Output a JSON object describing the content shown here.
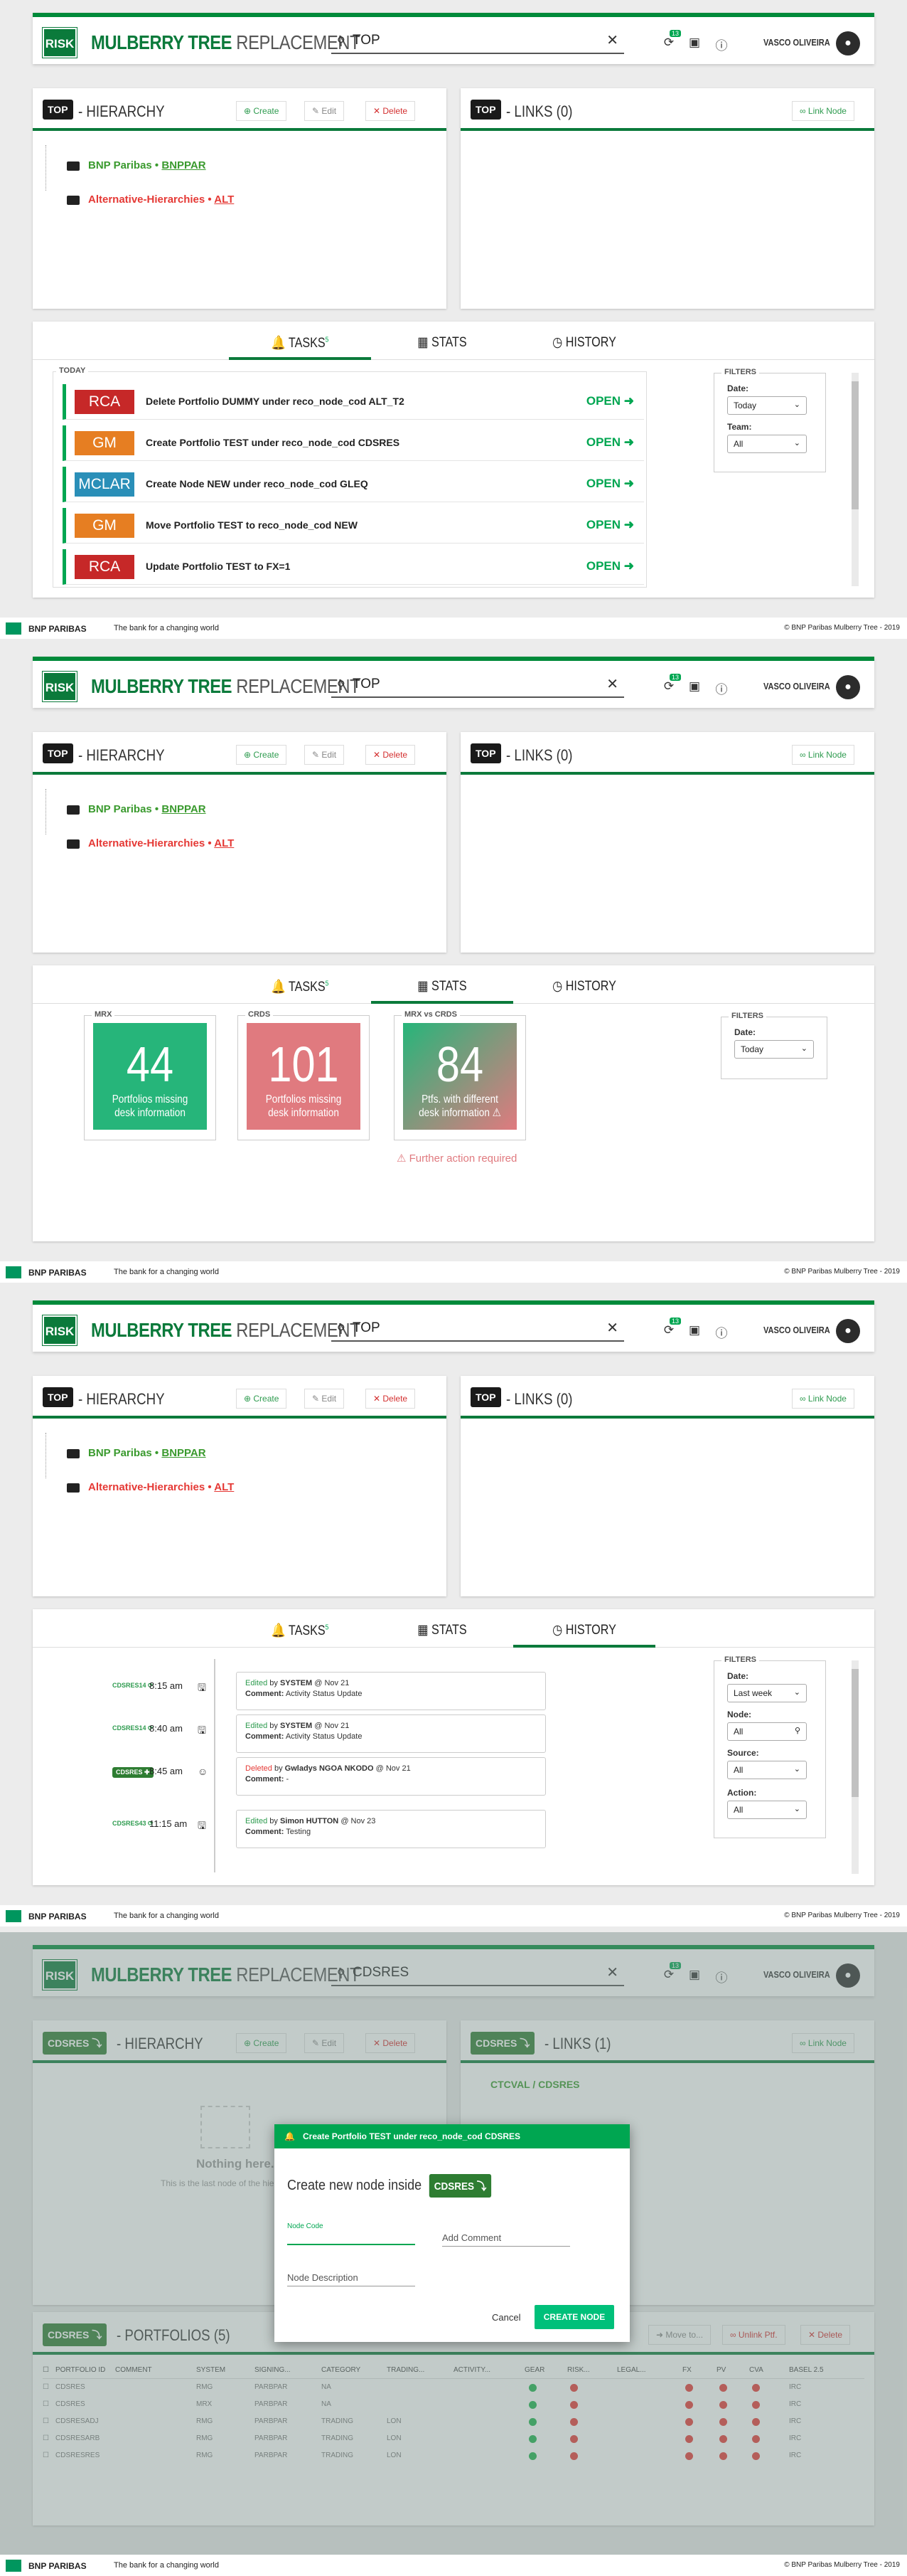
{
  "app": {
    "logo": "RISK",
    "title_bold": "MULBERRY TREE",
    "title_light": "REPLACEMENT",
    "user": "VASCO OLIVEIRA",
    "notif_count": "13"
  },
  "search": {
    "value_top": "TOP",
    "value_cdsres": "CDSRES"
  },
  "hierarchy": {
    "tag": "TOP",
    "title": "- HIERARCHY",
    "create": "Create",
    "edit": "Edit",
    "delete": "Delete",
    "nodes": [
      {
        "name": "BNP Paribas",
        "sep": " • ",
        "code": "BNPPAR",
        "color": "#3a9a2e"
      },
      {
        "name": "Alternative-Hierarchies",
        "sep": " • ",
        "code": "ALT",
        "color": "#e53935"
      }
    ]
  },
  "links": {
    "tag": "TOP",
    "title": "- LINKS (0)",
    "link_node": "Link Node"
  },
  "tabs": {
    "tasks": "TASKS",
    "tasks_badge": "5",
    "stats": "STATS",
    "history": "HISTORY"
  },
  "tasks": {
    "group": "TODAY",
    "items": [
      {
        "tag": "RCA",
        "color": "#c62828",
        "text": "Delete Portfolio DUMMY under reco_node_cod ALT_T2",
        "status": "OPEN"
      },
      {
        "tag": "GM",
        "color": "#e67e22",
        "text": "Create Portfolio TEST under reco_node_cod CDSRES",
        "status": "OPEN"
      },
      {
        "tag": "MCLAR",
        "color": "#2a8fb8",
        "text": "Create Node NEW under reco_node_cod GLEQ",
        "status": "OPEN"
      },
      {
        "tag": "GM",
        "color": "#e67e22",
        "text": "Move Portfolio TEST to reco_node_cod NEW",
        "status": "OPEN"
      },
      {
        "tag": "RCA",
        "color": "#c62828",
        "text": "Update Portfolio TEST to FX=1",
        "status": "OPEN"
      }
    ]
  },
  "filters": {
    "title": "FILTERS",
    "date_label": "Date:",
    "date_today": "Today",
    "date_lastweek": "Last week",
    "team_label": "Team:",
    "team_value": "All",
    "node_label": "Node:",
    "node_value": "All",
    "source_label": "Source:",
    "source_value": "All",
    "action_label": "Action:",
    "action_value": "All"
  },
  "stats": [
    {
      "title": "MRX",
      "value": "44",
      "label": "Portfolios missing desk information",
      "color": "#26b57a"
    },
    {
      "title": "CRDS",
      "value": "101",
      "label": "Portfolios missing desk information",
      "color": "#e07a7f"
    },
    {
      "title": "MRX vs CRDS",
      "value": "84",
      "label": "Ptfs. with different desk information ⚠",
      "color": "#5aa86a"
    }
  ],
  "stats_warning": "Further action required",
  "history": [
    {
      "badge": "CDSRES14 ⟳",
      "time": "8:15 am",
      "kind": "Edited",
      "by": "SYSTEM",
      "on": "Nov 21",
      "comment": "Activity Status Update"
    },
    {
      "badge": "CDSRES14 ⟳",
      "time": "8:40 am",
      "kind": "Edited",
      "by": "SYSTEM",
      "on": "Nov 21",
      "comment": "Activity Status Update"
    },
    {
      "badge": "CDSRES ✚",
      "time": "8:45 am",
      "kind": "Deleted",
      "by": "Gwladys NGOA NKODO",
      "on": "Nov 21",
      "comment": "-"
    },
    {
      "badge": "CDSRES43 ⟳",
      "time": "11:15 am",
      "kind": "Edited",
      "by": "Simon HUTTON",
      "on": "Nov 23",
      "comment": "Testing"
    }
  ],
  "history_labels": {
    "by": "by",
    "at": "@",
    "comment": "Comment:"
  },
  "footer": {
    "bank": "BNP PARIBAS",
    "tagline": "The bank for a changing world",
    "copy": "© BNP Paribas Mulberry Tree - 2019"
  },
  "screen4": {
    "hier_tag": "CDSRES",
    "links_title": "- LINKS (1)",
    "link_path": "CTCVAL / CDSRES",
    "empty_title": "Nothing here.",
    "empty_sub": "This is the last node of the hierarchy.",
    "portfolios_title": "- PORTFOLIOS (5)",
    "move_to": "Move to...",
    "unlink": "Unlink Ptf.",
    "delete": "Delete",
    "columns": [
      "PORTFOLIO ID",
      "COMMENT",
      "SYSTEM",
      "SIGNING...",
      "CATEGORY",
      "TRADING...",
      "ACTIVITY...",
      "GEAR",
      "RISK...",
      "LEGAL...",
      "FX",
      "PV",
      "CVA",
      "BASEL 2.5"
    ],
    "rows": [
      {
        "id": "CDSRES",
        "system": "RMG",
        "signing": "PARBPAR",
        "category": "NA",
        "trading": "",
        "basel": "IRC"
      },
      {
        "id": "CDSRES",
        "system": "MRX",
        "signing": "PARBPAR",
        "category": "NA",
        "trading": "",
        "basel": "IRC"
      },
      {
        "id": "CDSRESADJ",
        "system": "RMG",
        "signing": "PARBPAR",
        "category": "TRADING",
        "trading": "LON",
        "basel": "IRC"
      },
      {
        "id": "CDSRESARB",
        "system": "RMG",
        "signing": "PARBPAR",
        "category": "TRADING",
        "trading": "LON",
        "basel": "IRC"
      },
      {
        "id": "CDSRESRES",
        "system": "RMG",
        "signing": "PARBPAR",
        "category": "TRADING",
        "trading": "LON",
        "basel": "IRC"
      }
    ]
  },
  "modal": {
    "title": "Create Portfolio TEST under reco_node_cod CDSRES",
    "heading": "Create new node inside",
    "node_tag": "CDSRES",
    "node_code": "Node Code",
    "add_comment": "Add Comment",
    "node_description": "Node Description",
    "cancel": "Cancel",
    "create": "CREATE NODE"
  }
}
